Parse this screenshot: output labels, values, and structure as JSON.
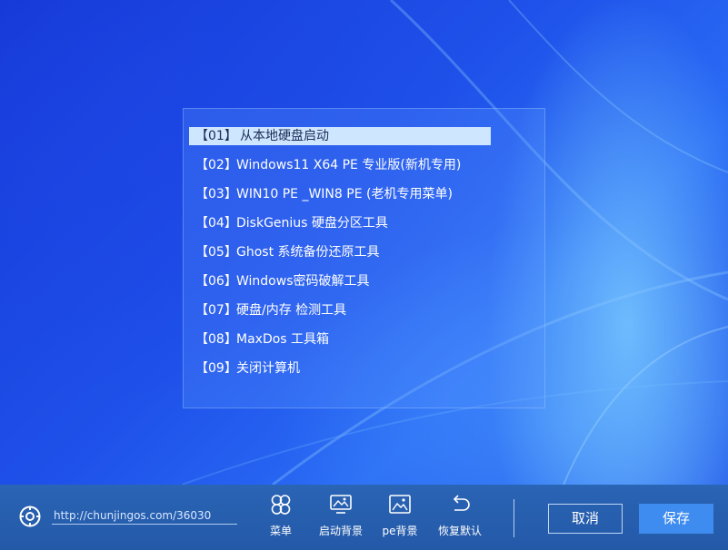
{
  "boot_menu": {
    "items": [
      {
        "num": "【01】",
        "label": "从本地硬盘启动",
        "selected": true
      },
      {
        "num": "【02】",
        "label": "Windows11 X64 PE 专业版(新机专用)"
      },
      {
        "num": "【03】",
        "label": "WIN10 PE _WIN8 PE (老机专用菜单)"
      },
      {
        "num": "【04】",
        "label": "DiskGenius 硬盘分区工具"
      },
      {
        "num": "【05】",
        "label": "Ghost 系统备份还原工具"
      },
      {
        "num": "【06】",
        "label": "Windows密码破解工具"
      },
      {
        "num": "【07】",
        "label": "硬盘/内存 检测工具"
      },
      {
        "num": "【08】",
        "label": "MaxDos 工具箱"
      },
      {
        "num": "【09】",
        "label": "关闭计算机"
      }
    ]
  },
  "toolbar": {
    "settings_icon": "gear-icon",
    "url": "http://chunjingos.com/36030",
    "menu_label": "菜单",
    "boot_bg_label": "启动背景",
    "pe_bg_label": "pe背景",
    "restore_label": "恢复默认",
    "cancel_label": "取消",
    "save_label": "保存"
  },
  "colors": {
    "taskbar": "#2a64b5",
    "selected_item": "#cfe6ff",
    "save_button": "#3f8cf0"
  }
}
